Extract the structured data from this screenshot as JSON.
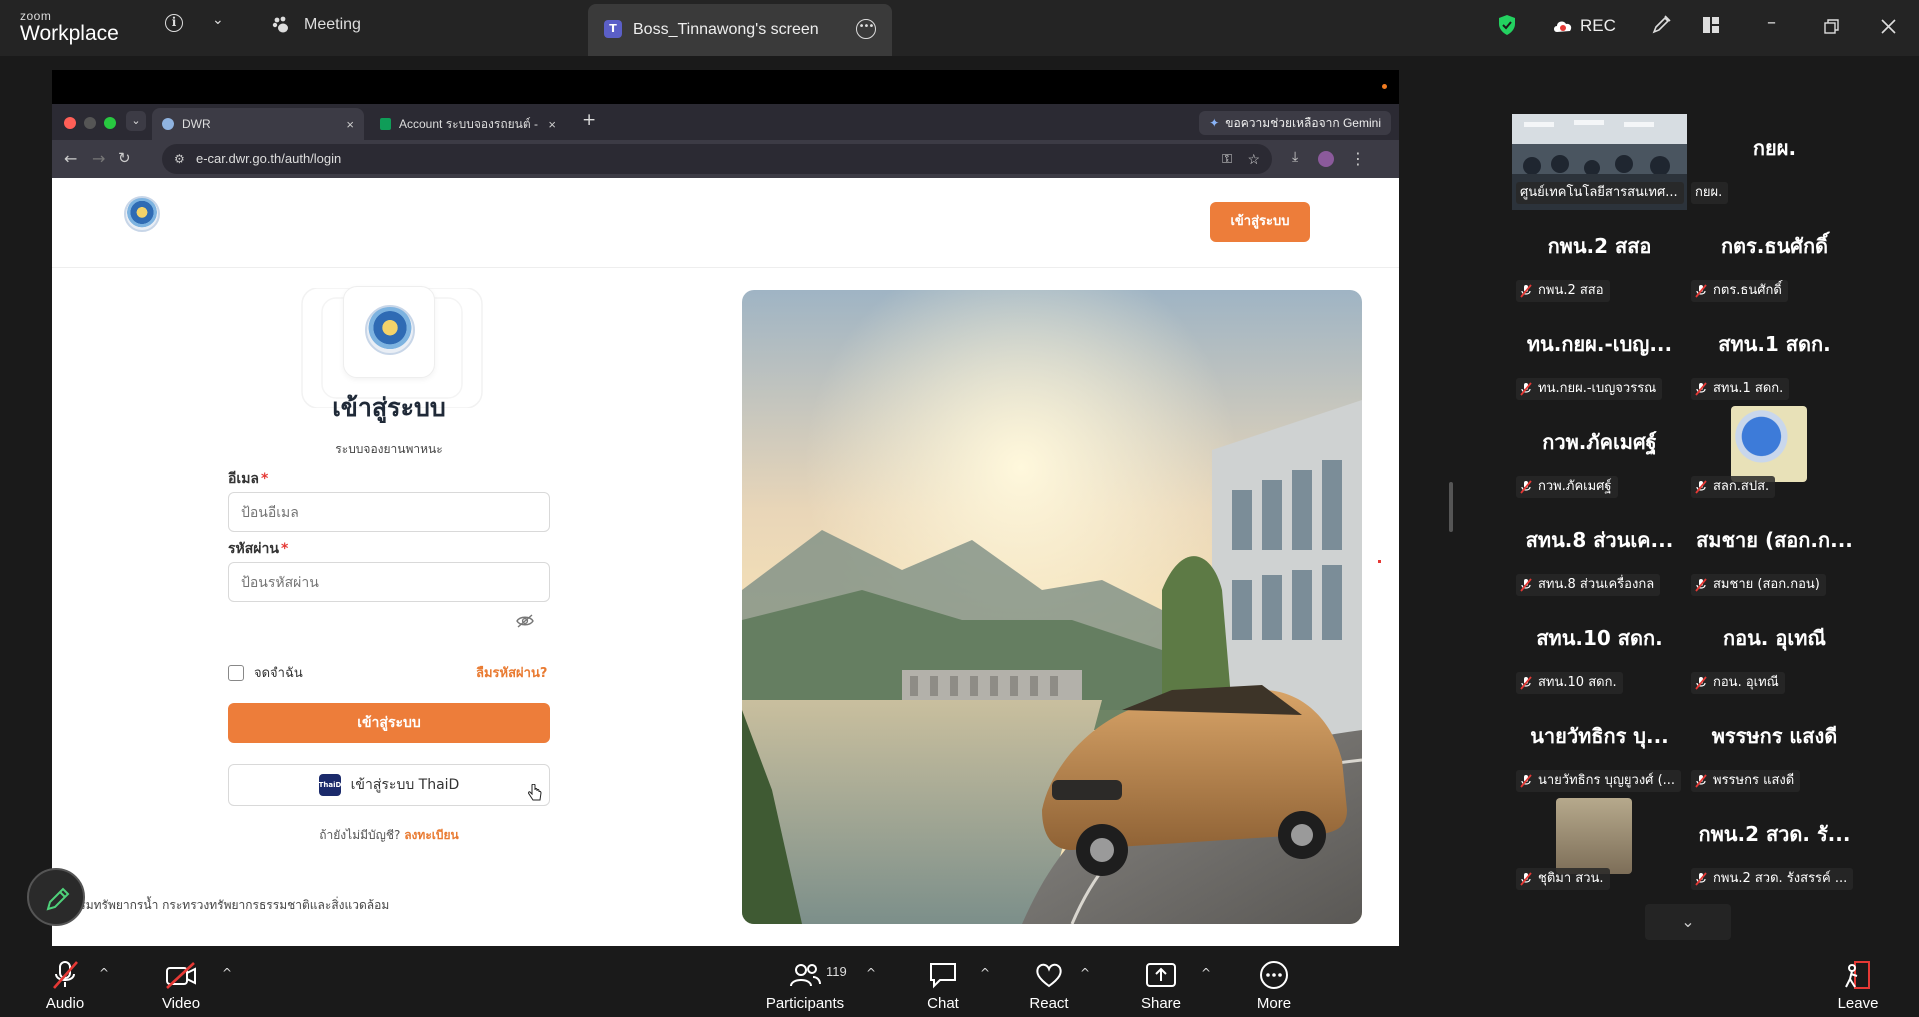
{
  "zoom": {
    "logo_line1": "zoom",
    "logo_line2": "Workplace",
    "info_icon": "i",
    "meeting_tab": "Meeting",
    "screen_tab_badge": "T",
    "screen_tab": "Boss_Tinnawong's screen",
    "rec_label": "REC",
    "accent_green": "#23d160",
    "accent_orange": "#ed7d3a"
  },
  "browser": {
    "tabs": [
      {
        "label": "DWR",
        "close": "×"
      },
      {
        "label": "Account ระบบจองรถยนต์ - Goo",
        "close": "×"
      }
    ],
    "new_tab": "+",
    "gemini_chip": "ขอความช่วยเหลือจาก Gemini",
    "url": "e-car.dwr.go.th/auth/login"
  },
  "page": {
    "header_login_button": "เข้าสู่ระบบ",
    "title": "เข้าสู่ระบบ",
    "subtitle": "ระบบจองยานพาหนะ",
    "email_label": "อีเมล",
    "email_placeholder": "ป้อนอีเมล",
    "password_label": "รหัสผ่าน",
    "password_placeholder": "ป้อนรหัสผ่าน",
    "required_mark": "*",
    "remember_me": "จดจำฉัน",
    "forgot_password": "ลืมรหัสผ่าน?",
    "login_button": "เข้าสู่ระบบ",
    "thaid_logo_text": "ThaiD",
    "thaid_button": "เข้าสู่ระบบ ThaiD",
    "no_account": "ถ้ายังไม่มีบัญชี?",
    "register": "ลงทะเบียน",
    "footer": "กรมทรัพยากรน้ำ กระทรวงทรัพยากรธรรมชาติและสิ่งแวดล้อม"
  },
  "participants": [
    {
      "display": "",
      "name": "ศูนย์เทคโนโลยีสารสนเทศ...",
      "muted": false,
      "video": true,
      "active": true
    },
    {
      "display": "กยผ.",
      "name": "กยผ.",
      "muted": false,
      "video": false
    },
    {
      "display": "กพน.2 สสอ",
      "name": "กพน.2 สสอ",
      "muted": true,
      "video": false
    },
    {
      "display": "กตร.ธนศักดิ์",
      "name": "กตร.ธนศักดิ์",
      "muted": true,
      "video": false
    },
    {
      "display": "ทน.กยผ.-เบญ...",
      "name": "ทน.กยผ.-เบญจวรรณ",
      "muted": true,
      "video": false
    },
    {
      "display": "สทน.1 สดก.",
      "name": "สทน.1 สดก.",
      "muted": true,
      "video": false
    },
    {
      "display": "กวพ.ภัคเมศฐ์",
      "name": "กวพ.ภัคเมศฐ์",
      "muted": true,
      "video": false
    },
    {
      "display": "",
      "name": "สลก.สปส.",
      "muted": true,
      "video": false,
      "avatar": true
    },
    {
      "display": "สทน.8 ส่วนเค...",
      "name": "สทน.8 ส่วนเครื่องกล",
      "muted": true,
      "video": false
    },
    {
      "display": "สมชาย (สอก.ก...",
      "name": "สมชาย (สอก.กอน)",
      "muted": true,
      "video": false
    },
    {
      "display": "สทน.10 สดก.",
      "name": "สทน.10 สดก.",
      "muted": true,
      "video": false
    },
    {
      "display": "กอน. อุเทณี",
      "name": "กอน. อุเทณี",
      "muted": true,
      "video": false
    },
    {
      "display": "นายวัทธิกร บุ...",
      "name": "นายวัทธิกร บุญยูวงศ์ (...",
      "muted": true,
      "video": false
    },
    {
      "display": "พรรษกร แสงดี",
      "name": "พรรษกร แสงดี",
      "muted": true,
      "video": false
    },
    {
      "display": "",
      "name": "ชุติมา สวน.",
      "muted": true,
      "video": false,
      "avatar": true
    },
    {
      "display": "กพน.2 สวด. รั...",
      "name": "กพน.2 สวด. รังสรรค์ ...",
      "muted": true,
      "video": false
    }
  ],
  "toolbar": {
    "audio": "Audio",
    "video": "Video",
    "participants": "Participants",
    "participant_count": "119",
    "chat": "Chat",
    "react": "React",
    "share": "Share",
    "more": "More",
    "leave": "Leave"
  }
}
